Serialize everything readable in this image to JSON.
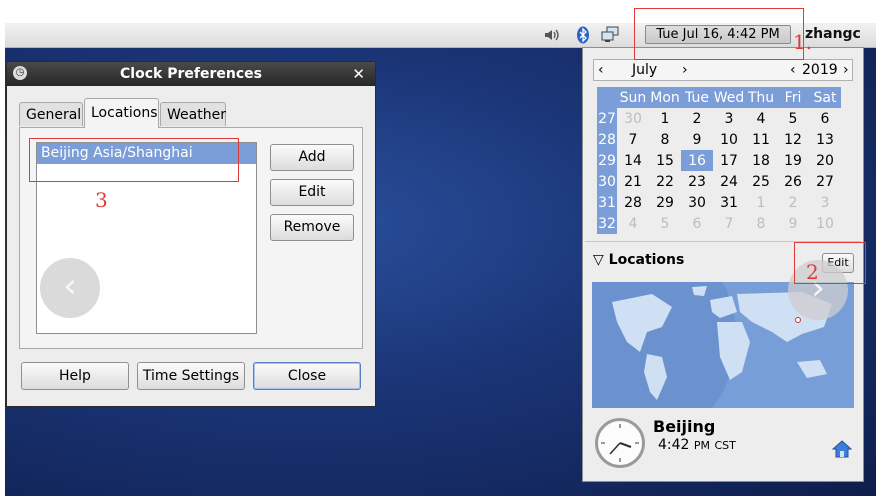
{
  "panel": {
    "datetime": "Tue Jul 16,  4:42 PM",
    "username": "zhangc",
    "tray_icons": [
      "speaker-icon",
      "bluetooth-icon",
      "network-icon"
    ]
  },
  "dialog": {
    "title": "Clock Preferences",
    "tabs": [
      "General",
      "Locations",
      "Weather"
    ],
    "active_tab": "Locations",
    "locations": [
      {
        "label": "Beijing  Asia/Shanghai"
      }
    ],
    "side_buttons": {
      "add": "Add",
      "edit": "Edit",
      "remove": "Remove"
    },
    "footer_buttons": {
      "help": "Help",
      "time_settings": "Time Settings",
      "close": "Close"
    }
  },
  "calendar": {
    "month": "July",
    "year": "2019",
    "weekday_headers": [
      "Sun",
      "Mon",
      "Tue",
      "Wed",
      "Thu",
      "Fri",
      "Sat"
    ],
    "weeks": [
      {
        "num": "27",
        "days": [
          [
            "30",
            true
          ],
          [
            "1",
            false
          ],
          [
            "2",
            false
          ],
          [
            "3",
            false
          ],
          [
            "4",
            false
          ],
          [
            "5",
            false
          ],
          [
            "6",
            false
          ]
        ]
      },
      {
        "num": "28",
        "days": [
          [
            "7",
            false
          ],
          [
            "8",
            false
          ],
          [
            "9",
            false
          ],
          [
            "10",
            false
          ],
          [
            "11",
            false
          ],
          [
            "12",
            false
          ],
          [
            "13",
            false
          ]
        ]
      },
      {
        "num": "29",
        "days": [
          [
            "14",
            false
          ],
          [
            "15",
            false
          ],
          [
            "16",
            false
          ],
          [
            "17",
            false
          ],
          [
            "18",
            false
          ],
          [
            "19",
            false
          ],
          [
            "20",
            false
          ]
        ]
      },
      {
        "num": "30",
        "days": [
          [
            "21",
            false
          ],
          [
            "22",
            false
          ],
          [
            "23",
            false
          ],
          [
            "24",
            false
          ],
          [
            "25",
            false
          ],
          [
            "26",
            false
          ],
          [
            "27",
            false
          ]
        ]
      },
      {
        "num": "31",
        "days": [
          [
            "28",
            false
          ],
          [
            "29",
            false
          ],
          [
            "30",
            false
          ],
          [
            "31",
            false
          ],
          [
            "1",
            true
          ],
          [
            "2",
            true
          ],
          [
            "3",
            true
          ]
        ]
      },
      {
        "num": "32",
        "days": [
          [
            "4",
            true
          ],
          [
            "5",
            true
          ],
          [
            "6",
            true
          ],
          [
            "7",
            true
          ],
          [
            "8",
            true
          ],
          [
            "9",
            true
          ],
          [
            "10",
            true
          ]
        ]
      }
    ],
    "selected_day": "16"
  },
  "locations_panel": {
    "header": "Locations",
    "edit_label": "Edit",
    "city": "Beijing",
    "time": "4:42",
    "ampm": "PM",
    "tz": "CST"
  },
  "annotations": [
    "1.",
    "2",
    "3"
  ],
  "colors": {
    "selection": "#7b9ed8",
    "annotation": "#e03a3a",
    "titlebar": "#2e2e2e"
  }
}
